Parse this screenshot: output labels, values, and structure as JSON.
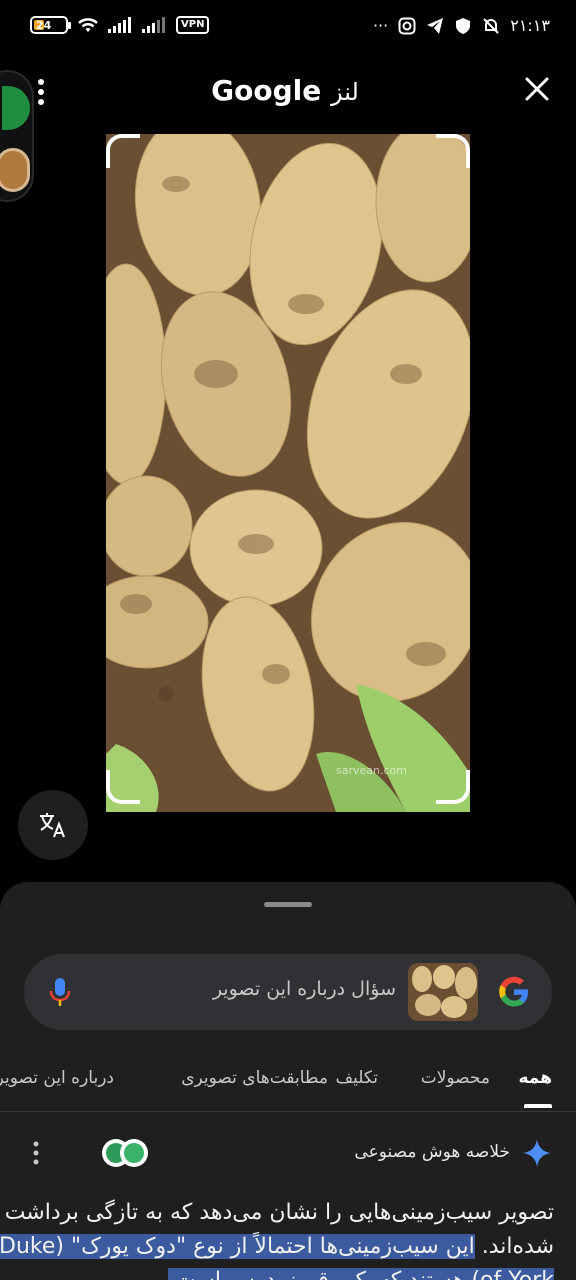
{
  "status_bar": {
    "battery": "24",
    "vpn": "VPN",
    "time": "۲۱:۱۳",
    "more": "···"
  },
  "header": {
    "brand": "Google",
    "suffix": "لنز"
  },
  "image": {
    "watermark": "sarvean.com"
  },
  "search": {
    "placeholder": "سؤال درباره این تصویر"
  },
  "tabs": [
    {
      "label": "همه",
      "active": true
    },
    {
      "label": "محصولات"
    },
    {
      "label": "تکلیف"
    },
    {
      "label": "مطابقت‌های تصویری"
    },
    {
      "label": "درباره این تصویر"
    }
  ],
  "ai_overview": {
    "label": "خلاصه هوش مصنوعی",
    "text_plain": "تصویر سیب‌زمینی‌هایی را نشان می‌دهد که به تازگی برداشت شده‌اند. ",
    "text_highlight": "این سیب‌زمینی‌ها احتمالاً از نوع \"دوک یورک\" (Duke of York) هستند که یک رقم زودرس است."
  },
  "colors": {
    "sheet_bg": "#1f1f1f",
    "search_bg": "#303134",
    "highlight": "#3b5b9e",
    "sparkle": "#4f8ef7"
  }
}
